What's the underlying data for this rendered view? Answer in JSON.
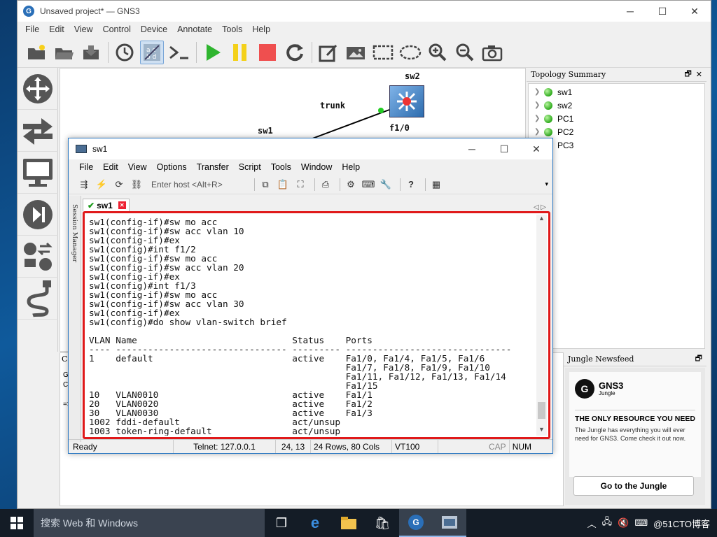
{
  "gns3": {
    "title": "Unsaved project* — GNS3",
    "menu": [
      "File",
      "Edit",
      "View",
      "Control",
      "Device",
      "Annotate",
      "Tools",
      "Help"
    ],
    "canvas": {
      "sw2_label": "sw2",
      "sw1_label": "sw1",
      "trunk_label": "trunk",
      "port_label": "f1/0"
    },
    "topology": {
      "title": "Topology Summary",
      "items": [
        "sw1",
        "sw2",
        "PC1",
        "PC2",
        "PC3"
      ]
    },
    "jungle": {
      "title": "Jungle Newsfeed",
      "brand": "GNS3",
      "brand_sub": "Jungle",
      "headline": "THE ONLY RESOURCE YOU NEED",
      "text": "The Jungle has everything you will ever need for GNS3. Come check it out now.",
      "button": "Go to the Jungle"
    },
    "console_snippets": {
      "a": "Co",
      "b": "Gb",
      "c": "Co",
      "d": "=>"
    }
  },
  "crt": {
    "title": "sw1",
    "menu": [
      "File",
      "Edit",
      "View",
      "Options",
      "Transfer",
      "Script",
      "Tools",
      "Window",
      "Help"
    ],
    "host_placeholder": "Enter host <Alt+R>",
    "session_manager": "Session Manager",
    "tab_label": "sw1",
    "terminal_lines": [
      "sw1(config-if)#sw mo acc",
      "sw1(config-if)#sw acc vlan 10",
      "sw1(config-if)#ex",
      "sw1(config)#int f1/2",
      "sw1(config-if)#sw mo acc",
      "sw1(config-if)#sw acc vlan 20",
      "sw1(config-if)#ex",
      "sw1(config)#int f1/3",
      "sw1(config-if)#sw mo acc",
      "sw1(config-if)#sw acc vlan 30",
      "sw1(config-if)#ex",
      "sw1(config)#do show vlan-switch brief",
      "",
      "VLAN Name                             Status    Ports",
      "---- -------------------------------- --------- -------------------------------",
      "1    default                          active    Fa1/0, Fa1/4, Fa1/5, Fa1/6",
      "                                                Fa1/7, Fa1/8, Fa1/9, Fa1/10",
      "                                                Fa1/11, Fa1/12, Fa1/13, Fa1/14",
      "                                                Fa1/15",
      "10   VLAN0010                         active    Fa1/1",
      "20   VLAN0020                         active    Fa1/2",
      "30   VLAN0030                         active    Fa1/3",
      "1002 fddi-default                     act/unsup",
      "1003 token-ring-default               act/unsup"
    ],
    "status": {
      "state": "Ready",
      "connection": "Telnet: 127.0.0.1",
      "cursor": "24,  13",
      "size": "24 Rows, 80 Cols",
      "emulation": "VT100",
      "cap": "CAP",
      "num": "NUM"
    }
  },
  "taskbar": {
    "search_placeholder": "搜索 Web 和 Windows",
    "tray_text": "@51CTO博客"
  },
  "colors": {
    "highlight_border": "#e0191a",
    "link_dot": "#22cc22"
  }
}
